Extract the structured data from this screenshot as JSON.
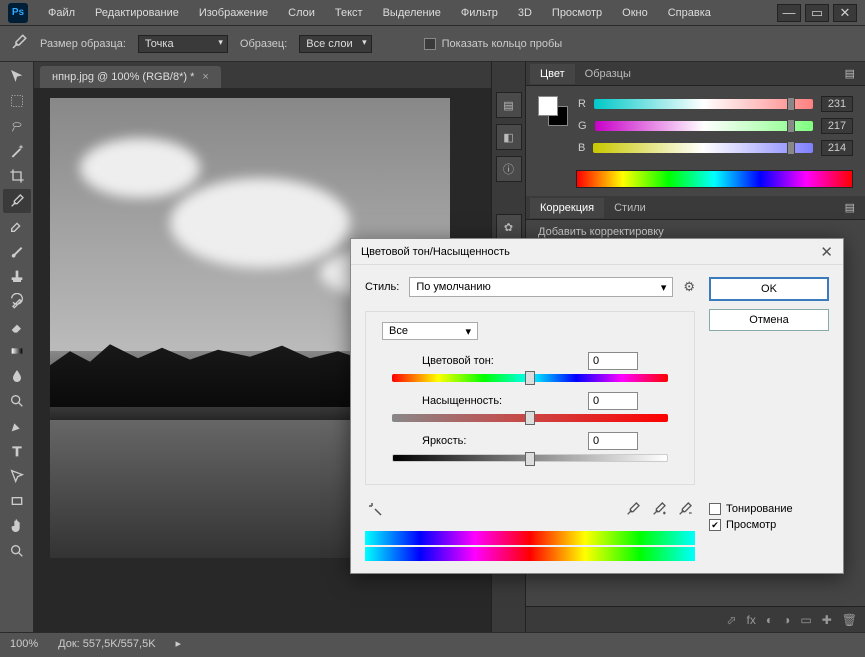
{
  "app": {
    "logo": "Ps"
  },
  "menu": [
    "Файл",
    "Редактирование",
    "Изображение",
    "Слои",
    "Текст",
    "Выделение",
    "Фильтр",
    "3D",
    "Просмотр",
    "Окно",
    "Справка"
  ],
  "options": {
    "sample_size_label": "Размер образца:",
    "sample_size_value": "Точка",
    "sample_label": "Образец:",
    "sample_value": "Все слои",
    "show_ring_label": "Показать кольцо пробы"
  },
  "doc": {
    "tab_title": "нпнр.jpg @ 100% (RGB/8*) *",
    "zoom": "100%",
    "doc_info": "Док: 557,5K/557,5K"
  },
  "color_panel": {
    "tab_color": "Цвет",
    "tab_swatches": "Образцы",
    "r_label": "R",
    "r_val": "231",
    "g_label": "G",
    "g_val": "217",
    "b_label": "B",
    "b_val": "214"
  },
  "adjustments_panel": {
    "tab_corr": "Коррекция",
    "tab_styles": "Стили",
    "add_label": "Добавить корректировку"
  },
  "dialog": {
    "title": "Цветовой тон/Насыщенность",
    "style_label": "Стиль:",
    "style_value": "По умолчанию",
    "channel_value": "Все",
    "hue_label": "Цветовой тон:",
    "hue_value": "0",
    "sat_label": "Насыщенность:",
    "sat_value": "0",
    "light_label": "Яркость:",
    "light_value": "0",
    "ok": "OK",
    "cancel": "Отмена",
    "colorize": "Тонирование",
    "preview": "Просмотр"
  }
}
